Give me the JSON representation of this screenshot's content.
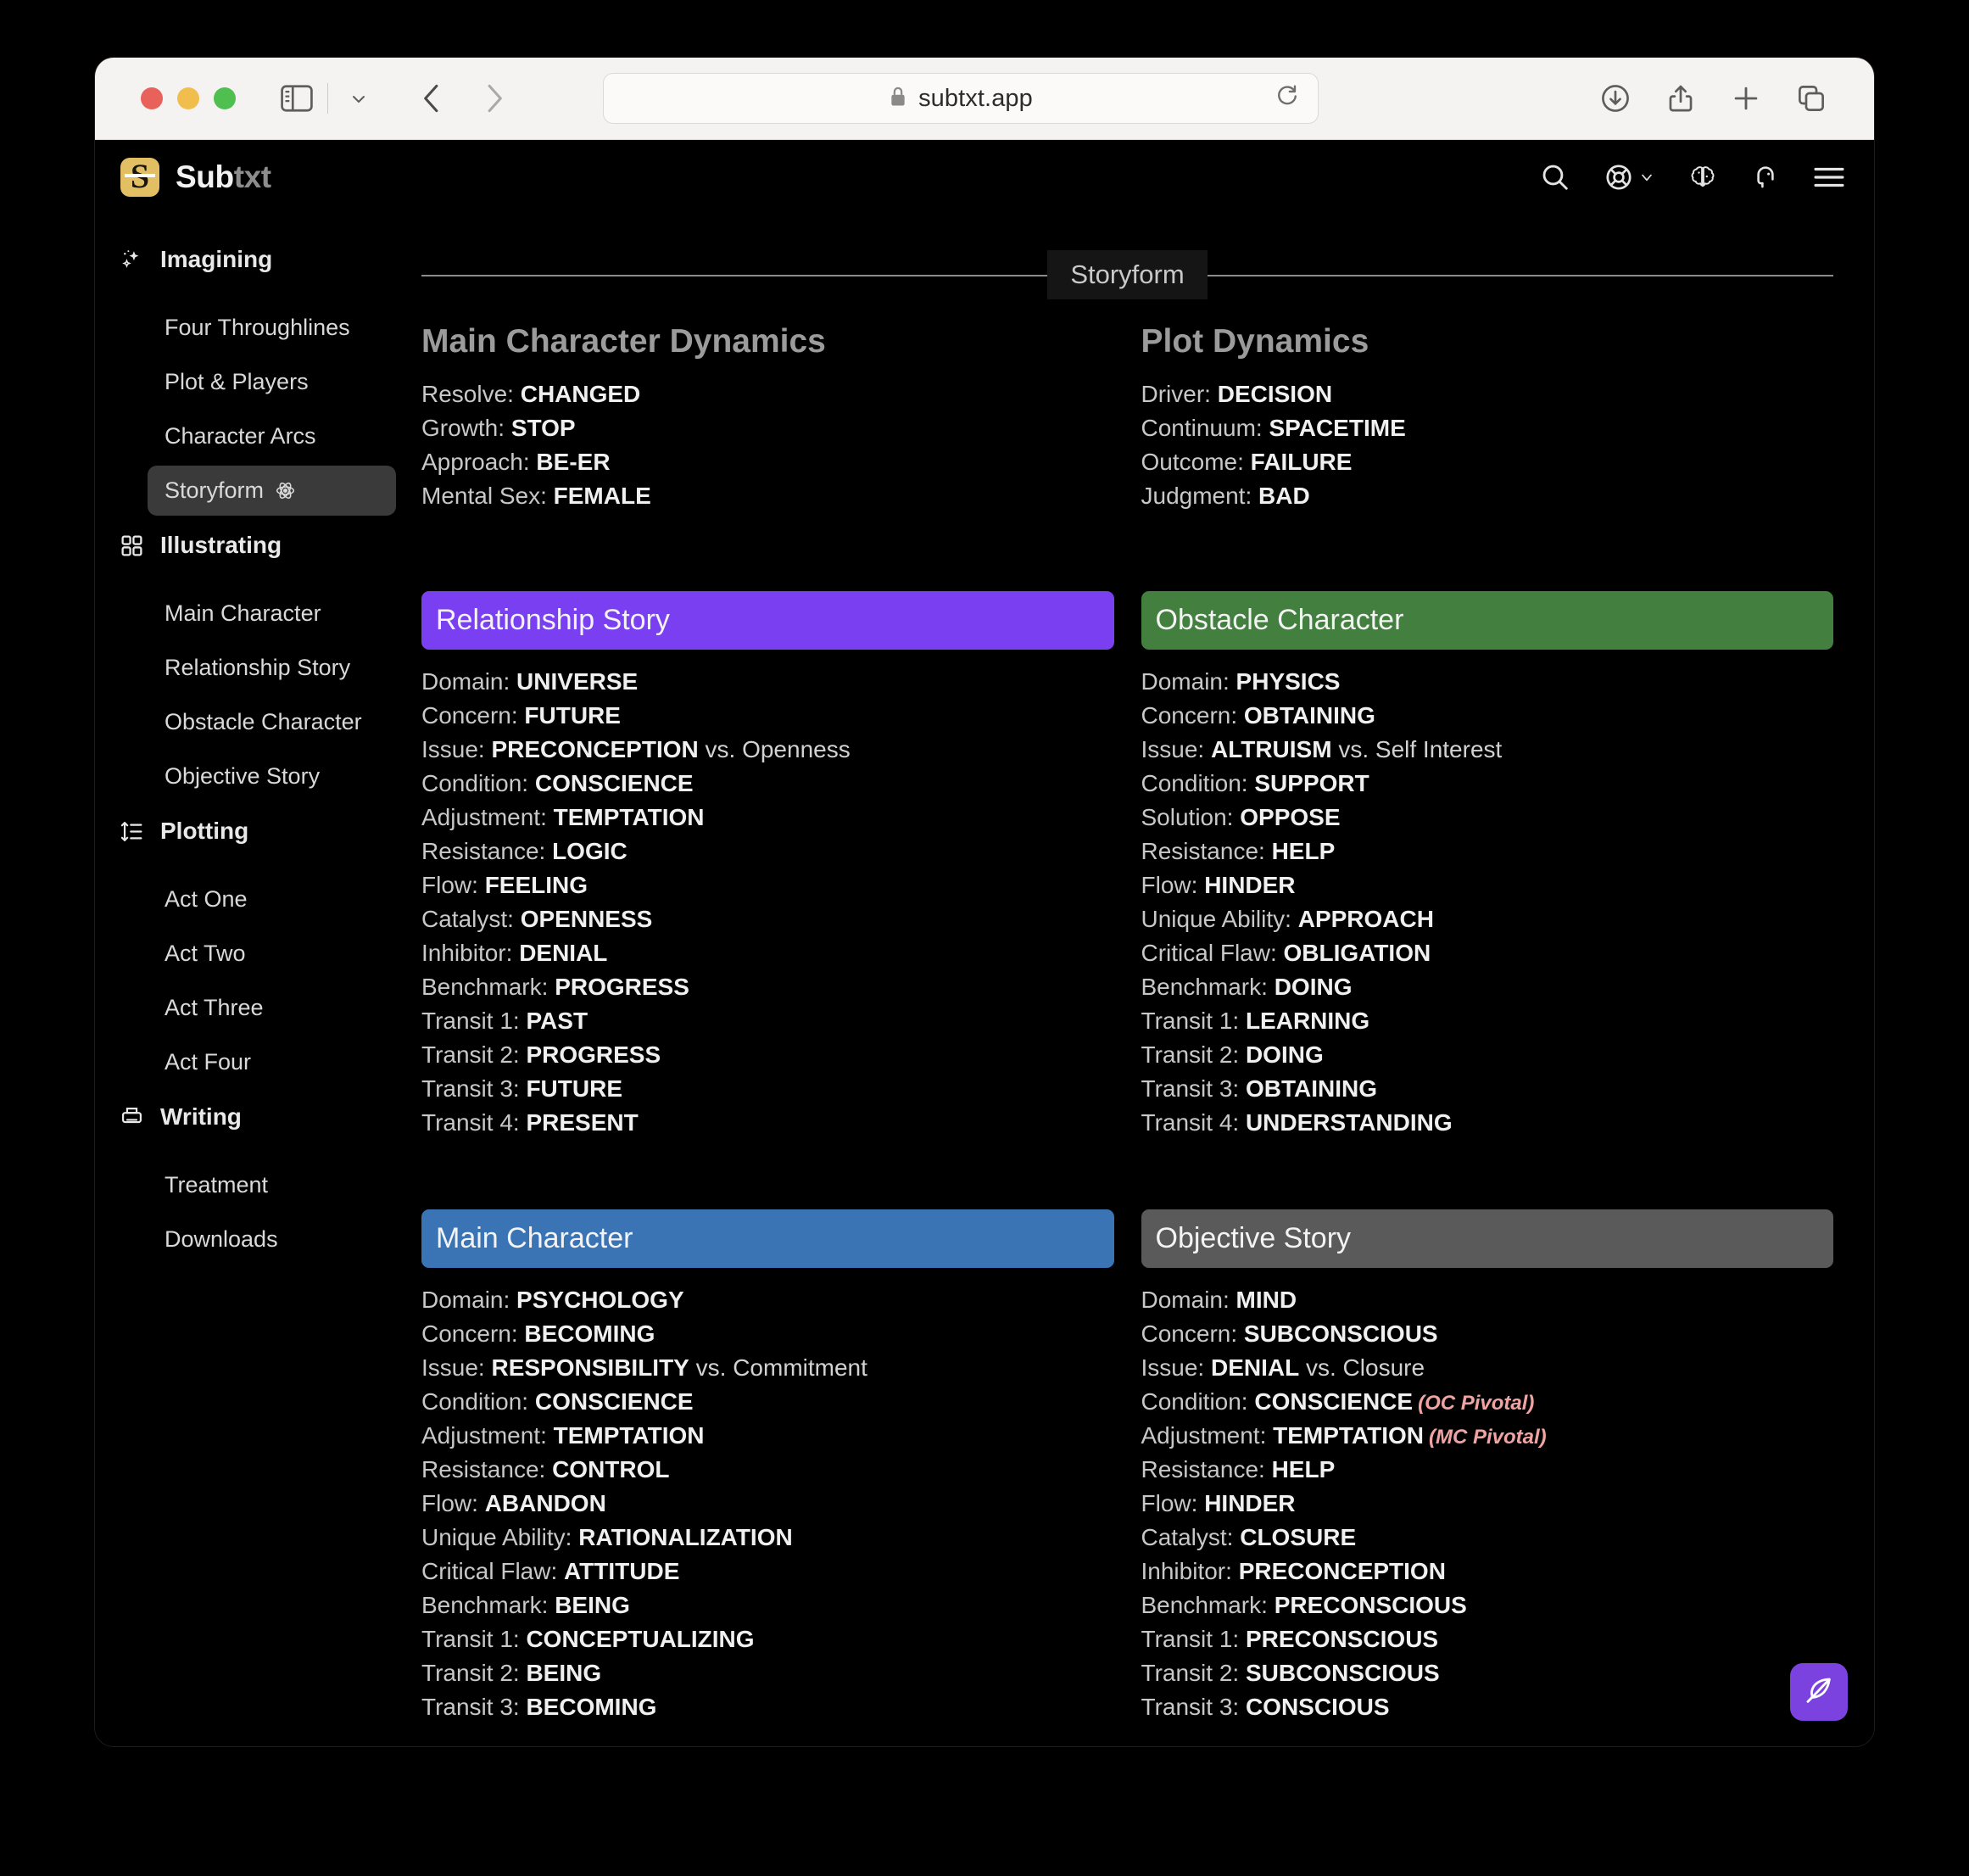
{
  "browser": {
    "url": "subtxt.app",
    "lock_icon": "lock-icon",
    "reload_icon": "reload-icon",
    "back_icon": "back-chevron-icon",
    "forward_icon": "forward-chevron-icon",
    "sidebar_icon": "sidebar-toggle-icon",
    "tabs_chevron_icon": "chevron-down-icon",
    "download_icon": "download-icon",
    "share_icon": "share-icon",
    "newtab_icon": "plus-icon",
    "tabgroup_icon": "tab-overview-icon"
  },
  "app": {
    "brand_primary": "Sub",
    "brand_secondary": "txt",
    "logo_letter": "S",
    "header_icons": [
      {
        "name": "search-icon"
      },
      {
        "name": "lifebuoy-icon"
      },
      {
        "name": "brain-icon"
      },
      {
        "name": "support-headset-icon"
      },
      {
        "name": "hamburger-menu-icon"
      }
    ]
  },
  "sidebar": {
    "groups": [
      {
        "label": "Imagining",
        "icon": "sparkles-icon",
        "items": [
          {
            "label": "Four Throughlines",
            "active": false
          },
          {
            "label": "Plot & Players",
            "active": false
          },
          {
            "label": "Character Arcs",
            "active": false
          },
          {
            "label": "Storyform",
            "active": true,
            "trailing_icon": "atom-icon"
          }
        ]
      },
      {
        "label": "Illustrating",
        "icon": "grid-icon",
        "items": [
          {
            "label": "Main Character",
            "active": false
          },
          {
            "label": "Relationship Story",
            "active": false
          },
          {
            "label": "Obstacle Character",
            "active": false
          },
          {
            "label": "Objective Story",
            "active": false
          }
        ]
      },
      {
        "label": "Plotting",
        "icon": "sort-icon",
        "items": [
          {
            "label": "Act One",
            "active": false
          },
          {
            "label": "Act Two",
            "active": false
          },
          {
            "label": "Act Three",
            "active": false
          },
          {
            "label": "Act Four",
            "active": false
          }
        ]
      },
      {
        "label": "Writing",
        "icon": "printer-icon",
        "items": [
          {
            "label": "Treatment",
            "active": false
          },
          {
            "label": "Downloads",
            "active": false
          }
        ]
      }
    ]
  },
  "main": {
    "section_label": "Storyform",
    "dynamics": [
      {
        "title": "Main Character Dynamics",
        "rows": [
          {
            "label": "Resolve:",
            "value": "CHANGED"
          },
          {
            "label": "Growth:",
            "value": "STOP"
          },
          {
            "label": "Approach:",
            "value": "BE-ER"
          },
          {
            "label": "Mental Sex:",
            "value": "FEMALE"
          }
        ]
      },
      {
        "title": "Plot Dynamics",
        "rows": [
          {
            "label": "Driver:",
            "value": "DECISION"
          },
          {
            "label": "Continuum:",
            "value": "SPACETIME"
          },
          {
            "label": "Outcome:",
            "value": "FAILURE"
          },
          {
            "label": "Judgment:",
            "value": "BAD"
          }
        ]
      }
    ],
    "cards": [
      {
        "title": "Relationship Story",
        "color": "#7b3ff2",
        "rows": [
          {
            "label": "Domain:",
            "value": "UNIVERSE"
          },
          {
            "label": "Concern:",
            "value": "FUTURE"
          },
          {
            "label": "Issue:",
            "value": "PRECONCEPTION",
            "tail": "vs. Openness"
          },
          {
            "label": "Condition:",
            "value": "CONSCIENCE"
          },
          {
            "label": "Adjustment:",
            "value": "TEMPTATION"
          },
          {
            "label": "Resistance:",
            "value": "LOGIC"
          },
          {
            "label": "Flow:",
            "value": "FEELING"
          },
          {
            "label": "Catalyst:",
            "value": "OPENNESS"
          },
          {
            "label": "Inhibitor:",
            "value": "DENIAL"
          },
          {
            "label": "Benchmark:",
            "value": "PROGRESS"
          },
          {
            "label": "Transit 1:",
            "value": "PAST"
          },
          {
            "label": "Transit 2:",
            "value": "PROGRESS"
          },
          {
            "label": "Transit 3:",
            "value": "FUTURE"
          },
          {
            "label": "Transit 4:",
            "value": "PRESENT"
          }
        ]
      },
      {
        "title": "Obstacle Character",
        "color": "#43803f",
        "rows": [
          {
            "label": "Domain:",
            "value": "PHYSICS"
          },
          {
            "label": "Concern:",
            "value": "OBTAINING"
          },
          {
            "label": "Issue:",
            "value": "ALTRUISM",
            "tail": "vs. Self Interest"
          },
          {
            "label": "Condition:",
            "value": "SUPPORT"
          },
          {
            "label": "Solution:",
            "value": "OPPOSE"
          },
          {
            "label": "Resistance:",
            "value": "HELP"
          },
          {
            "label": "Flow:",
            "value": "HINDER"
          },
          {
            "label": "Unique Ability:",
            "value": "APPROACH"
          },
          {
            "label": "Critical Flaw:",
            "value": "OBLIGATION"
          },
          {
            "label": "Benchmark:",
            "value": "DOING"
          },
          {
            "label": "Transit 1:",
            "value": "LEARNING"
          },
          {
            "label": "Transit 2:",
            "value": "DOING"
          },
          {
            "label": "Transit 3:",
            "value": "OBTAINING"
          },
          {
            "label": "Transit 4:",
            "value": "UNDERSTANDING"
          }
        ]
      },
      {
        "title": "Main Character",
        "color": "#3b74b5",
        "rows": [
          {
            "label": "Domain:",
            "value": "PSYCHOLOGY"
          },
          {
            "label": "Concern:",
            "value": "BECOMING"
          },
          {
            "label": "Issue:",
            "value": "RESPONSIBILITY",
            "tail": "vs. Commitment"
          },
          {
            "label": "Condition:",
            "value": "CONSCIENCE"
          },
          {
            "label": "Adjustment:",
            "value": "TEMPTATION"
          },
          {
            "label": "Resistance:",
            "value": "CONTROL"
          },
          {
            "label": "Flow:",
            "value": "ABANDON"
          },
          {
            "label": "Unique Ability:",
            "value": "RATIONALIZATION"
          },
          {
            "label": "Critical Flaw:",
            "value": "ATTITUDE"
          },
          {
            "label": "Benchmark:",
            "value": "BEING"
          },
          {
            "label": "Transit 1:",
            "value": "CONCEPTUALIZING"
          },
          {
            "label": "Transit 2:",
            "value": "BEING"
          },
          {
            "label": "Transit 3:",
            "value": "BECOMING"
          }
        ]
      },
      {
        "title": "Objective Story",
        "color": "#5a5a5a",
        "rows": [
          {
            "label": "Domain:",
            "value": "MIND"
          },
          {
            "label": "Concern:",
            "value": "SUBCONSCIOUS"
          },
          {
            "label": "Issue:",
            "value": "DENIAL",
            "tail": "vs. Closure"
          },
          {
            "label": "Condition:",
            "value": "CONSCIENCE",
            "pivot": "(OC Pivotal)"
          },
          {
            "label": "Adjustment:",
            "value": "TEMPTATION",
            "pivot": "(MC Pivotal)"
          },
          {
            "label": "Resistance:",
            "value": "HELP"
          },
          {
            "label": "Flow:",
            "value": "HINDER"
          },
          {
            "label": "Catalyst:",
            "value": "CLOSURE"
          },
          {
            "label": "Inhibitor:",
            "value": "PRECONCEPTION"
          },
          {
            "label": "Benchmark:",
            "value": "PRECONSCIOUS"
          },
          {
            "label": "Transit 1:",
            "value": "PRECONSCIOUS"
          },
          {
            "label": "Transit 2:",
            "value": "SUBCONSCIOUS"
          },
          {
            "label": "Transit 3:",
            "value": "CONSCIOUS"
          }
        ]
      }
    ],
    "fab_icon": "feather-quill-icon"
  }
}
